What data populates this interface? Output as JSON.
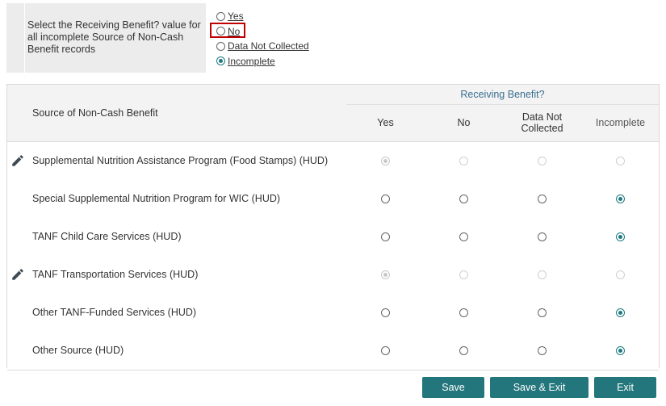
{
  "bulk": {
    "prompt": "Select the Receiving Benefit? value for all incomplete Source of Non-Cash Benefit records",
    "options": [
      {
        "label": "Yes",
        "checked": false,
        "highlighted": false
      },
      {
        "label": "No",
        "checked": false,
        "highlighted": true
      },
      {
        "label": "Data Not Collected",
        "checked": false,
        "highlighted": false
      },
      {
        "label": "Incomplete",
        "checked": true,
        "highlighted": false
      }
    ]
  },
  "table": {
    "source_header": "Source of Non-Cash Benefit",
    "group_header": "Receiving Benefit?",
    "columns": [
      "Yes",
      "No",
      "Data Not Collected",
      "Incomplete"
    ],
    "rows": [
      {
        "source": "Supplemental Nutrition Assistance Program (Food Stamps) (HUD)",
        "editable": true,
        "selected": "Yes",
        "disabled": true
      },
      {
        "source": "Special Supplemental Nutrition Program for WIC (HUD)",
        "editable": false,
        "selected": "Incomplete",
        "disabled": false
      },
      {
        "source": "TANF Child Care Services (HUD)",
        "editable": false,
        "selected": "Incomplete",
        "disabled": false
      },
      {
        "source": "TANF Transportation Services (HUD)",
        "editable": true,
        "selected": "Yes",
        "disabled": true
      },
      {
        "source": "Other TANF-Funded Services (HUD)",
        "editable": false,
        "selected": "Incomplete",
        "disabled": false
      },
      {
        "source": "Other Source (HUD)",
        "editable": false,
        "selected": "Incomplete",
        "disabled": false
      }
    ]
  },
  "buttons": {
    "save": "Save",
    "save_exit": "Save & Exit",
    "exit": "Exit"
  },
  "colors": {
    "accent": "#23767c",
    "highlight_box": "#c00000"
  },
  "icons": {
    "edit": "pencil-icon"
  }
}
